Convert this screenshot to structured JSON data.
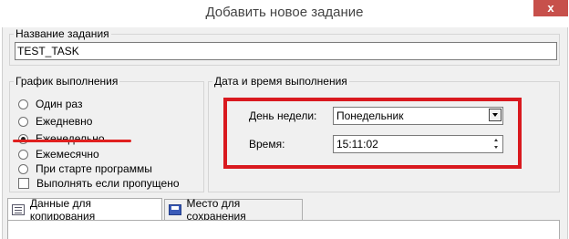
{
  "window": {
    "title": "Добавить новое задание",
    "close_glyph": "x"
  },
  "task_name": {
    "legend": "Название задания",
    "value": "TEST_TASK"
  },
  "schedule": {
    "legend": "График выполнения",
    "options": [
      {
        "label": "Один раз",
        "selected": false
      },
      {
        "label": "Ежедневно",
        "selected": false
      },
      {
        "label": "Еженедельно",
        "selected": true
      },
      {
        "label": "Ежемесячно",
        "selected": false
      },
      {
        "label": "При старте программы",
        "selected": false
      }
    ],
    "missed_checkbox": {
      "label": "Выполнять если пропущено",
      "checked": false
    }
  },
  "datetime": {
    "legend": "Дата и время выполнения",
    "weekday": {
      "label": "День недели:",
      "value": "Понедельник"
    },
    "time": {
      "label": "Время:",
      "value": "15:11:02"
    }
  },
  "tabs": [
    {
      "label": "Данные для копирования",
      "icon": "copy-icon",
      "active": true
    },
    {
      "label": "Место для сохранения",
      "icon": "save-icon",
      "active": false
    }
  ],
  "colors": {
    "highlight": "#d9191f",
    "close_button": "#c7504b",
    "background": "#f0f0f0"
  }
}
